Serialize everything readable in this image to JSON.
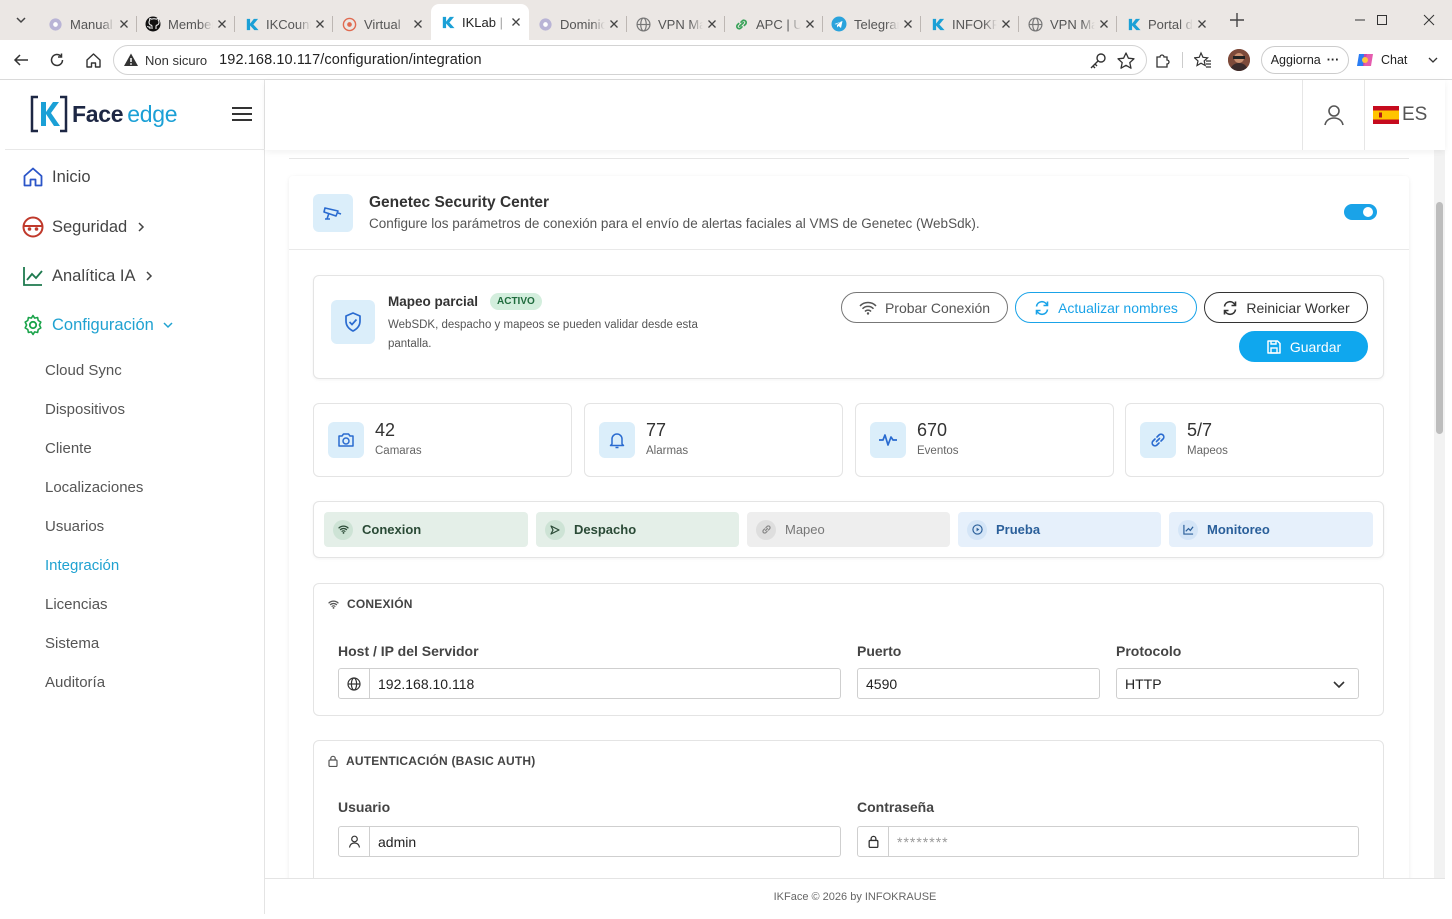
{
  "browser": {
    "tabs": [
      {
        "title": "Manual",
        "icon": "gear-icon"
      },
      {
        "title": "Member",
        "icon": "github-icon"
      },
      {
        "title": "IKCount",
        "icon": "ik-logo-icon"
      },
      {
        "title": "Virtual",
        "icon": "target-icon"
      },
      {
        "title": "IKLab | V",
        "icon": "ik-logo-icon",
        "active": true
      },
      {
        "title": "Dominio",
        "icon": "gear-icon"
      },
      {
        "title": "VPN Ma",
        "icon": "globe-icon"
      },
      {
        "title": "APC | UI",
        "icon": "link-icon"
      },
      {
        "title": "Telegram",
        "icon": "telegram-icon"
      },
      {
        "title": "INFOKR",
        "icon": "ik-logo-icon"
      },
      {
        "title": "VPN Ma",
        "icon": "globe-icon"
      },
      {
        "title": "Portal d",
        "icon": "ik-logo-icon"
      }
    ],
    "security_label": "Non sicuro",
    "url": "192.168.10.117/configuration/integration",
    "update_label": "Aggiorna",
    "chat_label": "Chat"
  },
  "brand": {
    "face": "Face",
    "edge": "edge",
    "k": "K"
  },
  "sidebar": {
    "items": [
      {
        "label": "Inicio",
        "icon": "home-icon"
      },
      {
        "label": "Seguridad",
        "icon": "security-icon",
        "has_chevron": true
      },
      {
        "label": "Analítica IA",
        "icon": "chart-line-icon",
        "has_chevron": true
      },
      {
        "label": "Configuración",
        "icon": "gear-icon",
        "has_chevron": true,
        "expanded": true
      }
    ],
    "subitems": [
      "Cloud Sync",
      "Dispositivos",
      "Cliente",
      "Localizaciones",
      "Usuarios",
      "Integración",
      "Licencias",
      "Sistema",
      "Auditoría"
    ],
    "active_subitem": "Integración"
  },
  "header": {
    "lang": "ES"
  },
  "integration": {
    "title": "Genetec Security Center",
    "subtitle": "Configure los parámetros de conexión para el envío de alertas faciales al VMS de Genetec (WebSdk).",
    "enabled": true
  },
  "mapping": {
    "title": "Mapeo parcial",
    "badge": "ACTIVO",
    "description": "WebSDK, despacho y mapeos se pueden validar desde esta pantalla.",
    "buttons": {
      "test": "Probar Conexión",
      "update_names": "Actualizar nombres",
      "restart": "Reiniciar Worker",
      "save": "Guardar"
    }
  },
  "stats": [
    {
      "value": "42",
      "label": "Camaras",
      "icon": "camera-icon"
    },
    {
      "value": "77",
      "label": "Alarmas",
      "icon": "bell-icon"
    },
    {
      "value": "670",
      "label": "Eventos",
      "icon": "activity-icon"
    },
    {
      "value": "5/7",
      "label": "Mapeos",
      "icon": "link-icon"
    }
  ],
  "steps": [
    {
      "label": "Conexion",
      "state": "done",
      "icon": "wifi-icon"
    },
    {
      "label": "Despacho",
      "state": "done",
      "icon": "send-icon"
    },
    {
      "label": "Mapeo",
      "state": "pending",
      "icon": "link-icon"
    },
    {
      "label": "Prueba",
      "state": "info",
      "icon": "play-icon"
    },
    {
      "label": "Monitoreo",
      "state": "info",
      "icon": "chart-line-icon"
    }
  ],
  "connection": {
    "heading": "CONEXIÓN",
    "host_label": "Host / IP del Servidor",
    "host_value": "192.168.10.118",
    "port_label": "Puerto",
    "port_value": "4590",
    "protocol_label": "Protocolo",
    "protocol_value": "HTTP"
  },
  "auth": {
    "heading": "AUTENTICACIÓN (BASIC AUTH)",
    "user_label": "Usuario",
    "user_value": "admin",
    "password_label": "Contraseña",
    "password_placeholder": "********"
  },
  "footer": {
    "text": "IKFace © 2026 by INFOKRAUSE"
  },
  "colors": {
    "accent": "#1aa3e8",
    "brand_dark": "#1d2744",
    "active_nav": "#20a2d1",
    "success_badge": "#d3eedd"
  }
}
